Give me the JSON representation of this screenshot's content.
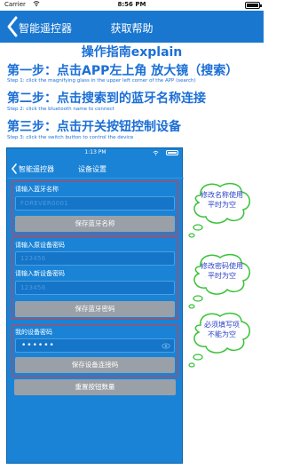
{
  "status_bar": {
    "carrier": "Carrier",
    "time": "8:56 PM"
  },
  "nav": {
    "back_label": "智能遥控器",
    "title": "获取帮助"
  },
  "guide": {
    "title": "操作指南explain",
    "steps": [
      {
        "title": "第一步：点击APP左上角 放大镜（搜索）",
        "desc": "Step 1: click the magnifying glass in the upper left corner of the APP (search)"
      },
      {
        "title": "第二步：点击搜索到的蓝牙名称连接",
        "desc": "Step 2: click the bluetooth name to connect"
      },
      {
        "title": "第三步：点击开关按钮控制设备",
        "desc": "Step 3: click the switch button to control the device"
      }
    ]
  },
  "screenshot": {
    "time": "1:13 PM",
    "back_label": "智能遥控器",
    "title": "设备设置",
    "name_group": {
      "label": "请输入蓝牙名称",
      "placeholder": "FOREVER0001",
      "button": "保存蓝牙名称"
    },
    "password_group": {
      "old_label": "请输入原设备密码",
      "old_placeholder": "123456",
      "new_label": "请输入新设备密码",
      "new_placeholder": "123456",
      "button": "保存蓝牙密码"
    },
    "connect_group": {
      "label": "我的设备密码",
      "value": "••••••",
      "button": "保存设备连接码"
    },
    "reset_button": "重置按钮数量"
  },
  "bubbles": {
    "name_note": "修改名称使用\n平时为空",
    "password_note": "修改密码使用\n平时为空",
    "required_note": "必须填写项\n不能为空"
  },
  "colors": {
    "nav_blue": "#1a77d0",
    "guide_blue": "#1b6fd6",
    "bubble_stroke": "#3ac23a",
    "highlight_red": "#e33"
  }
}
